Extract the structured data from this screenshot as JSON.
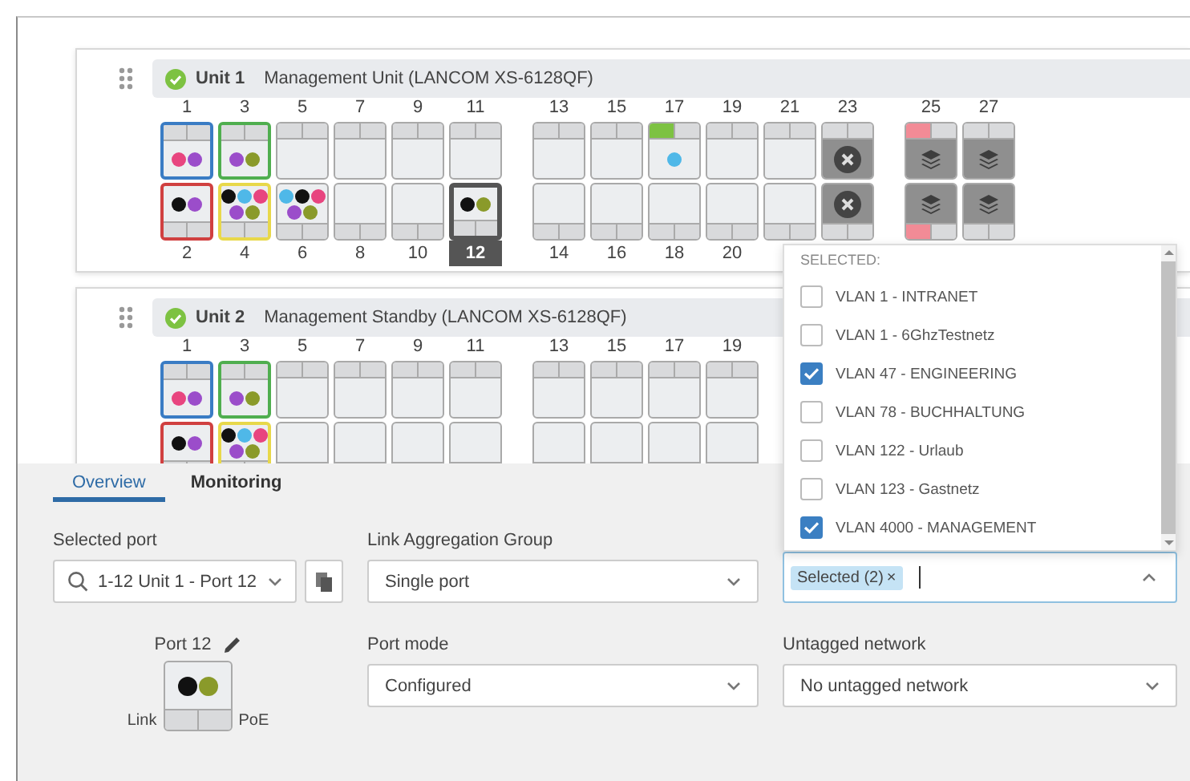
{
  "units": [
    {
      "title": "Unit 1",
      "description": "Management Unit (LANCOM XS-6128QF)",
      "groups": [
        [
          {
            "top": {
              "number": "1",
              "kind": "port",
              "selected": false,
              "color": "#3a7cc4",
              "dots": [
                {
                  "color": "#e8457f"
                },
                {
                  "color": "#9b4dca"
                }
              ]
            },
            "bottom": {
              "number": "2",
              "kind": "port",
              "selected": false,
              "color": "#d04040",
              "dots": [
                {
                  "color": "#111111"
                },
                {
                  "color": "#9b4dca"
                }
              ]
            }
          },
          {
            "top": {
              "number": "3",
              "kind": "port",
              "selected": false,
              "color": "#4fae4f",
              "dots": [
                {
                  "color": "#9b4dca"
                },
                {
                  "color": "#8a9a2a"
                }
              ]
            },
            "bottom": {
              "number": "4",
              "kind": "port",
              "selected": false,
              "color": "#e8d84a",
              "dots": [
                {
                  "color": "#111111"
                },
                {
                  "color": "#4fb8e8"
                },
                {
                  "color": "#e8457f"
                },
                {
                  "color": "#9b4dca"
                },
                {
                  "color": "#8a9a2a"
                }
              ]
            }
          },
          {
            "top": {
              "number": "5",
              "kind": "port",
              "selected": false
            },
            "bottom": {
              "number": "6",
              "kind": "port",
              "selected": false,
              "dots": [
                {
                  "color": "#4fb8e8"
                },
                {
                  "color": "#111111"
                },
                {
                  "color": "#e8457f"
                },
                {
                  "color": "#9b4dca"
                },
                {
                  "color": "#8a9a2a"
                }
              ]
            }
          },
          {
            "top": {
              "number": "7",
              "kind": "port",
              "selected": false
            },
            "bottom": {
              "number": "8",
              "kind": "port",
              "selected": false
            }
          },
          {
            "top": {
              "number": "9",
              "kind": "port",
              "selected": false
            },
            "bottom": {
              "number": "10",
              "kind": "port",
              "selected": false
            }
          },
          {
            "top": {
              "number": "11",
              "kind": "port",
              "selected": false
            },
            "bottom": {
              "number": "12",
              "kind": "port",
              "selected": true,
              "dots": [
                {
                  "color": "#111111"
                },
                {
                  "color": "#8a9a2a"
                }
              ]
            }
          }
        ],
        [
          {
            "top": {
              "number": "13",
              "kind": "port",
              "selected": false
            },
            "bottom": {
              "number": "14",
              "kind": "port",
              "selected": false
            }
          },
          {
            "top": {
              "number": "15",
              "kind": "port",
              "selected": false
            },
            "bottom": {
              "number": "16",
              "kind": "port",
              "selected": false
            }
          },
          {
            "top": {
              "number": "17",
              "kind": "port",
              "selected": false,
              "link_led": {
                "color": "#7dc242"
              },
              "dots": [
                {
                  "color": "#4fb8e8"
                }
              ]
            },
            "bottom": {
              "number": "18",
              "kind": "port",
              "selected": false
            }
          },
          {
            "top": {
              "number": "19",
              "kind": "port",
              "selected": false
            },
            "bottom": {
              "number": "20",
              "kind": "port",
              "selected": false
            }
          },
          {
            "top": {
              "number": "21",
              "kind": "port",
              "selected": false
            },
            "bottom": {
              "kind": "port",
              "selected": false
            }
          },
          {
            "top": {
              "number": "23",
              "kind": "disabled",
              "selected": false
            },
            "bottom": {
              "kind": "disabled",
              "selected": false
            }
          }
        ],
        [
          {
            "top": {
              "number": "25",
              "kind": "stack",
              "selected": false,
              "link_led": {
                "color": "#f28b96"
              }
            },
            "bottom": {
              "kind": "stack",
              "selected": false,
              "link_led": {
                "color": "#f28b96"
              }
            }
          },
          {
            "top": {
              "number": "27",
              "kind": "stack",
              "selected": false
            },
            "bottom": {
              "kind": "stack",
              "selected": false
            }
          }
        ]
      ]
    },
    {
      "title": "Unit 2",
      "description": "Management Standby (LANCOM XS-6128QF)",
      "groups": [
        [
          {
            "top": {
              "number": "1",
              "kind": "port",
              "selected": false,
              "color": "#3a7cc4",
              "dots": [
                {
                  "color": "#e8457f"
                },
                {
                  "color": "#9b4dca"
                }
              ]
            },
            "bottom": {
              "kind": "port",
              "selected": false,
              "color": "#d04040",
              "dots": [
                {
                  "color": "#111111"
                },
                {
                  "color": "#9b4dca"
                }
              ]
            }
          },
          {
            "top": {
              "number": "3",
              "kind": "port",
              "selected": false,
              "color": "#4fae4f",
              "dots": [
                {
                  "color": "#9b4dca"
                },
                {
                  "color": "#8a9a2a"
                }
              ]
            },
            "bottom": {
              "kind": "port",
              "selected": false,
              "color": "#e8d84a",
              "dots": [
                {
                  "color": "#111111"
                },
                {
                  "color": "#4fb8e8"
                },
                {
                  "color": "#e8457f"
                },
                {
                  "color": "#9b4dca"
                },
                {
                  "color": "#8a9a2a"
                }
              ]
            }
          },
          {
            "top": {
              "number": "5",
              "kind": "port",
              "selected": false
            },
            "bottom": {
              "kind": "port",
              "selected": false
            }
          },
          {
            "top": {
              "number": "7",
              "kind": "port",
              "selected": false
            },
            "bottom": {
              "kind": "port",
              "selected": false
            }
          },
          {
            "top": {
              "number": "9",
              "kind": "port",
              "selected": false
            },
            "bottom": {
              "kind": "port",
              "selected": false
            }
          },
          {
            "top": {
              "number": "11",
              "kind": "port",
              "selected": false
            },
            "bottom": {
              "kind": "port",
              "selected": false
            }
          }
        ],
        [
          {
            "top": {
              "number": "13",
              "kind": "port",
              "selected": false
            },
            "bottom": {
              "kind": "port",
              "selected": false
            }
          },
          {
            "top": {
              "number": "15",
              "kind": "port",
              "selected": false
            },
            "bottom": {
              "kind": "port",
              "selected": false
            }
          },
          {
            "top": {
              "number": "17",
              "kind": "port",
              "selected": false
            },
            "bottom": {
              "kind": "port",
              "selected": false
            }
          },
          {
            "top": {
              "number": "19",
              "kind": "port",
              "selected": false
            },
            "bottom": {
              "kind": "port",
              "selected": false
            }
          }
        ]
      ]
    }
  ],
  "panel": {
    "tabs": [
      {
        "label": "Overview",
        "selected": true
      },
      {
        "label": "Monitoring",
        "selected": false
      }
    ],
    "selected_port": {
      "label": "Selected port",
      "value": "1-12 Unit 1 - Port 12"
    },
    "lag": {
      "label": "Link Aggregation Group",
      "value": "Single port"
    },
    "vlans": {
      "focused": true,
      "tag": "Selected (2)",
      "tag_remove": "×",
      "options_header": "SELECTED:",
      "options": [
        {
          "label": "VLAN 1 - INTRANET",
          "checked": false
        },
        {
          "label": "VLAN 1 - 6GhzTestnetz",
          "checked": false
        },
        {
          "label": "VLAN 47 - ENGINEERING",
          "checked": true
        },
        {
          "label": "VLAN 78 - BUCHHALTUNG",
          "checked": false
        },
        {
          "label": "VLAN 122 - Urlaub",
          "checked": false
        },
        {
          "label": "VLAN 123 - Gastnetz",
          "checked": false
        },
        {
          "label": "VLAN 4000 - MANAGEMENT",
          "checked": true
        }
      ]
    },
    "port_preview": {
      "title": "Port 12",
      "dots": [
        {
          "color": "#111111"
        },
        {
          "color": "#8a9a2a"
        }
      ],
      "link_label": "Link",
      "poe_label": "PoE"
    },
    "port_mode": {
      "label": "Port mode",
      "value": "Configured"
    },
    "untagged": {
      "label": "Untagged network",
      "value": "No untagged network"
    }
  }
}
